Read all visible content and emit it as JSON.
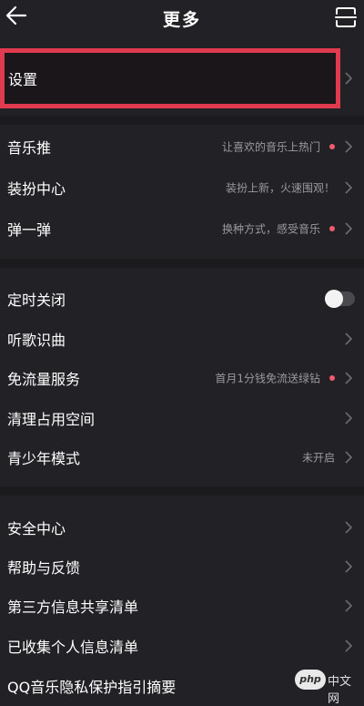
{
  "header": {
    "title": "更多"
  },
  "settings": {
    "label": "设置"
  },
  "group1": [
    {
      "label": "音乐推",
      "sub": "让喜欢的音乐上热门",
      "dot": true
    },
    {
      "label": "装扮中心",
      "sub": "装扮上新，火速围观！",
      "dot": false
    },
    {
      "label": "弹一弹",
      "sub": "换种方式，感受音乐",
      "dot": true
    }
  ],
  "group2": {
    "timer": {
      "label": "定时关闭",
      "toggle_on": false
    },
    "identify": {
      "label": "听歌识曲"
    },
    "free_data": {
      "label": "免流量服务",
      "sub": "首月1分钱免流送绿钻",
      "dot": true
    },
    "cleanup": {
      "label": "清理占用空间"
    },
    "teen": {
      "label": "青少年模式",
      "sub": "未开启"
    }
  },
  "group3": [
    {
      "label": "安全中心"
    },
    {
      "label": "帮助与反馈"
    },
    {
      "label": "第三方信息共享清单"
    },
    {
      "label": "已收集个人信息清单"
    },
    {
      "label": "QQ音乐隐私保护指引摘要"
    }
  ],
  "watermark": {
    "logo": "php",
    "text": "中文网"
  },
  "colors": {
    "background": "#222125",
    "highlight_border": "#e03a4e",
    "dot": "#f25a6e",
    "subtext": "#9b9a9f"
  }
}
